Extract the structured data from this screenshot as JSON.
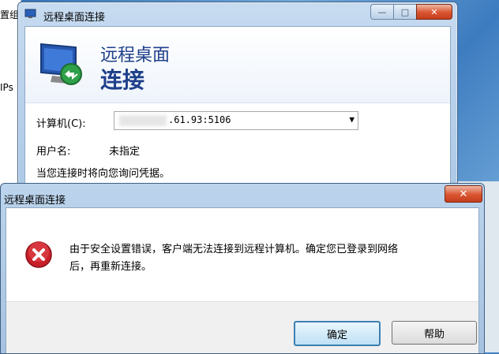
{
  "background": {
    "left_texts": [
      "置组",
      "IPs"
    ]
  },
  "back_window": {
    "title": "远程桌面连接",
    "controls": {
      "minimize": "—",
      "maximize": "□",
      "close": "✕"
    },
    "banner": {
      "line1": "远程桌面",
      "line2": "连接"
    },
    "computer_label": "计算机(C):",
    "computer_value": ".61.93:5106",
    "username_label": "用户名:",
    "username_value": "未指定",
    "credential_note": "当您连接时将向您询问凭据。"
  },
  "dialog": {
    "title": "远程桌面连接",
    "close": "✕",
    "message_line1": "由于安全设置错误，客户端无法连接到远程计算机。确定您已登录到网络",
    "message_line2": "后，再重新连接。",
    "ok_button": "确定",
    "help_button": "帮助"
  },
  "colors": {
    "banner_text": "#1e3f8a",
    "error_red": "#c8202a",
    "close_red": "#d9542f"
  }
}
